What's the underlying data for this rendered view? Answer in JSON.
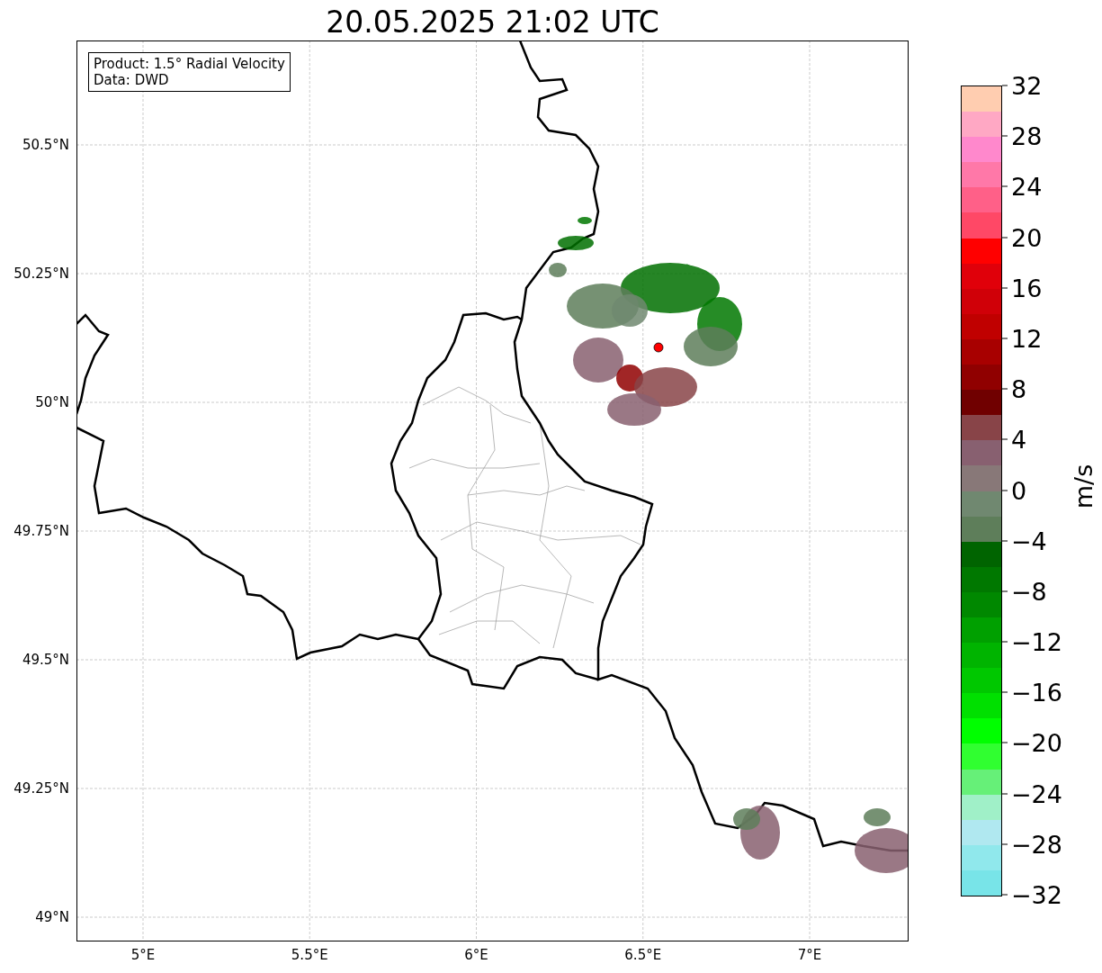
{
  "title": "20.05.2025 21:02 UTC",
  "info_box": {
    "lines": [
      "Product: 1.5° Radial Velocity",
      "Data: DWD"
    ]
  },
  "lat_ticks": [
    "50.5°N",
    "50.25°N",
    "50°N",
    "49.75°N",
    "49.5°N",
    "49.25°N",
    "49°N"
  ],
  "lon_ticks": [
    "5°E",
    "5.5°E",
    "6°E",
    "6.5°E",
    "7°E"
  ],
  "colorbar": {
    "label": "m/s",
    "ticks": [
      "32",
      "28",
      "24",
      "20",
      "16",
      "12",
      "8",
      "4",
      "0",
      "−4",
      "−8",
      "−12",
      "−16",
      "−20",
      "−24",
      "−28",
      "−32"
    ],
    "bands": [
      {
        "color": "#ffcdb0"
      },
      {
        "color": "#ffa8c4"
      },
      {
        "color": "#ff88cc"
      },
      {
        "color": "#ff78a8"
      },
      {
        "color": "#ff6088"
      },
      {
        "color": "#ff4866"
      },
      {
        "color": "#ff0000"
      },
      {
        "color": "#e0000a"
      },
      {
        "color": "#d00008"
      },
      {
        "color": "#c00000"
      },
      {
        "color": "#a80000"
      },
      {
        "color": "#900000"
      },
      {
        "color": "#700000"
      },
      {
        "color": "#884448"
      },
      {
        "color": "#886070"
      },
      {
        "color": "#887878"
      },
      {
        "color": "#708870"
      },
      {
        "color": "#5e7e5a"
      },
      {
        "color": "#006400"
      },
      {
        "color": "#007800"
      },
      {
        "color": "#008800"
      },
      {
        "color": "#00a000"
      },
      {
        "color": "#00b400"
      },
      {
        "color": "#00c800"
      },
      {
        "color": "#00e000"
      },
      {
        "color": "#00ff00"
      },
      {
        "color": "#30ff30"
      },
      {
        "color": "#66f078"
      },
      {
        "color": "#a0f0c8"
      },
      {
        "color": "#b0e8f0"
      },
      {
        "color": "#90e8ec"
      },
      {
        "color": "#78e4e8"
      }
    ]
  }
}
